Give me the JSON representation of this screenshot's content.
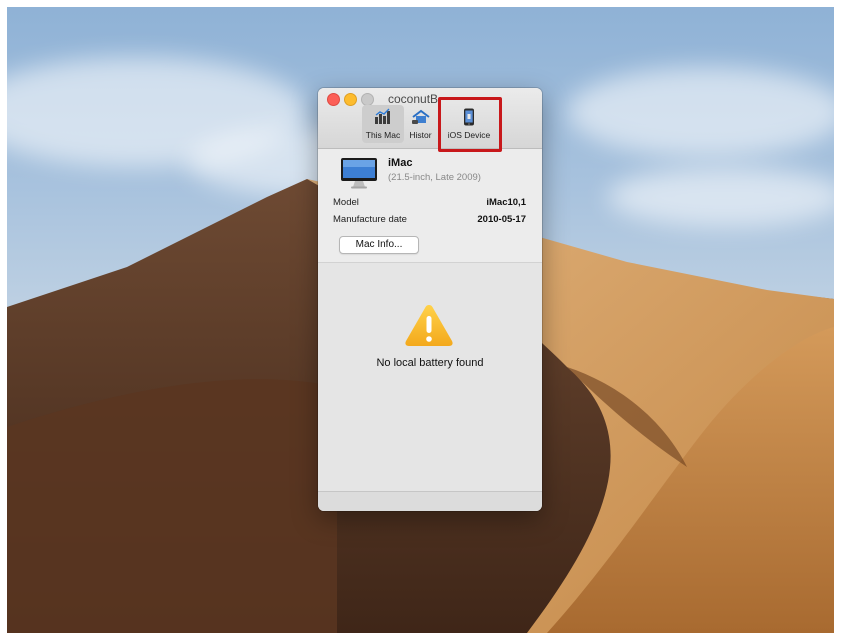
{
  "window": {
    "title": "coconutB",
    "toolbar": [
      {
        "label": "This Mac",
        "icon": "bar-chart-icon",
        "selected": true
      },
      {
        "label": "Histor",
        "icon": "history-icon",
        "selected": false
      },
      {
        "label": "iOS Device",
        "icon": "iphone-icon",
        "selected": false
      }
    ]
  },
  "mac": {
    "name": "iMac",
    "subtitle": "(21.5-inch, Late 2009)",
    "model_label": "Model",
    "model_value": "iMac10,1",
    "date_label": "Manufacture date",
    "date_value": "2010-05-17",
    "info_button": "Mac Info..."
  },
  "battery": {
    "message": "No local battery found",
    "icon": "warning-icon"
  },
  "annotation": {
    "color": "#c8181b",
    "target": "iOS Device"
  }
}
